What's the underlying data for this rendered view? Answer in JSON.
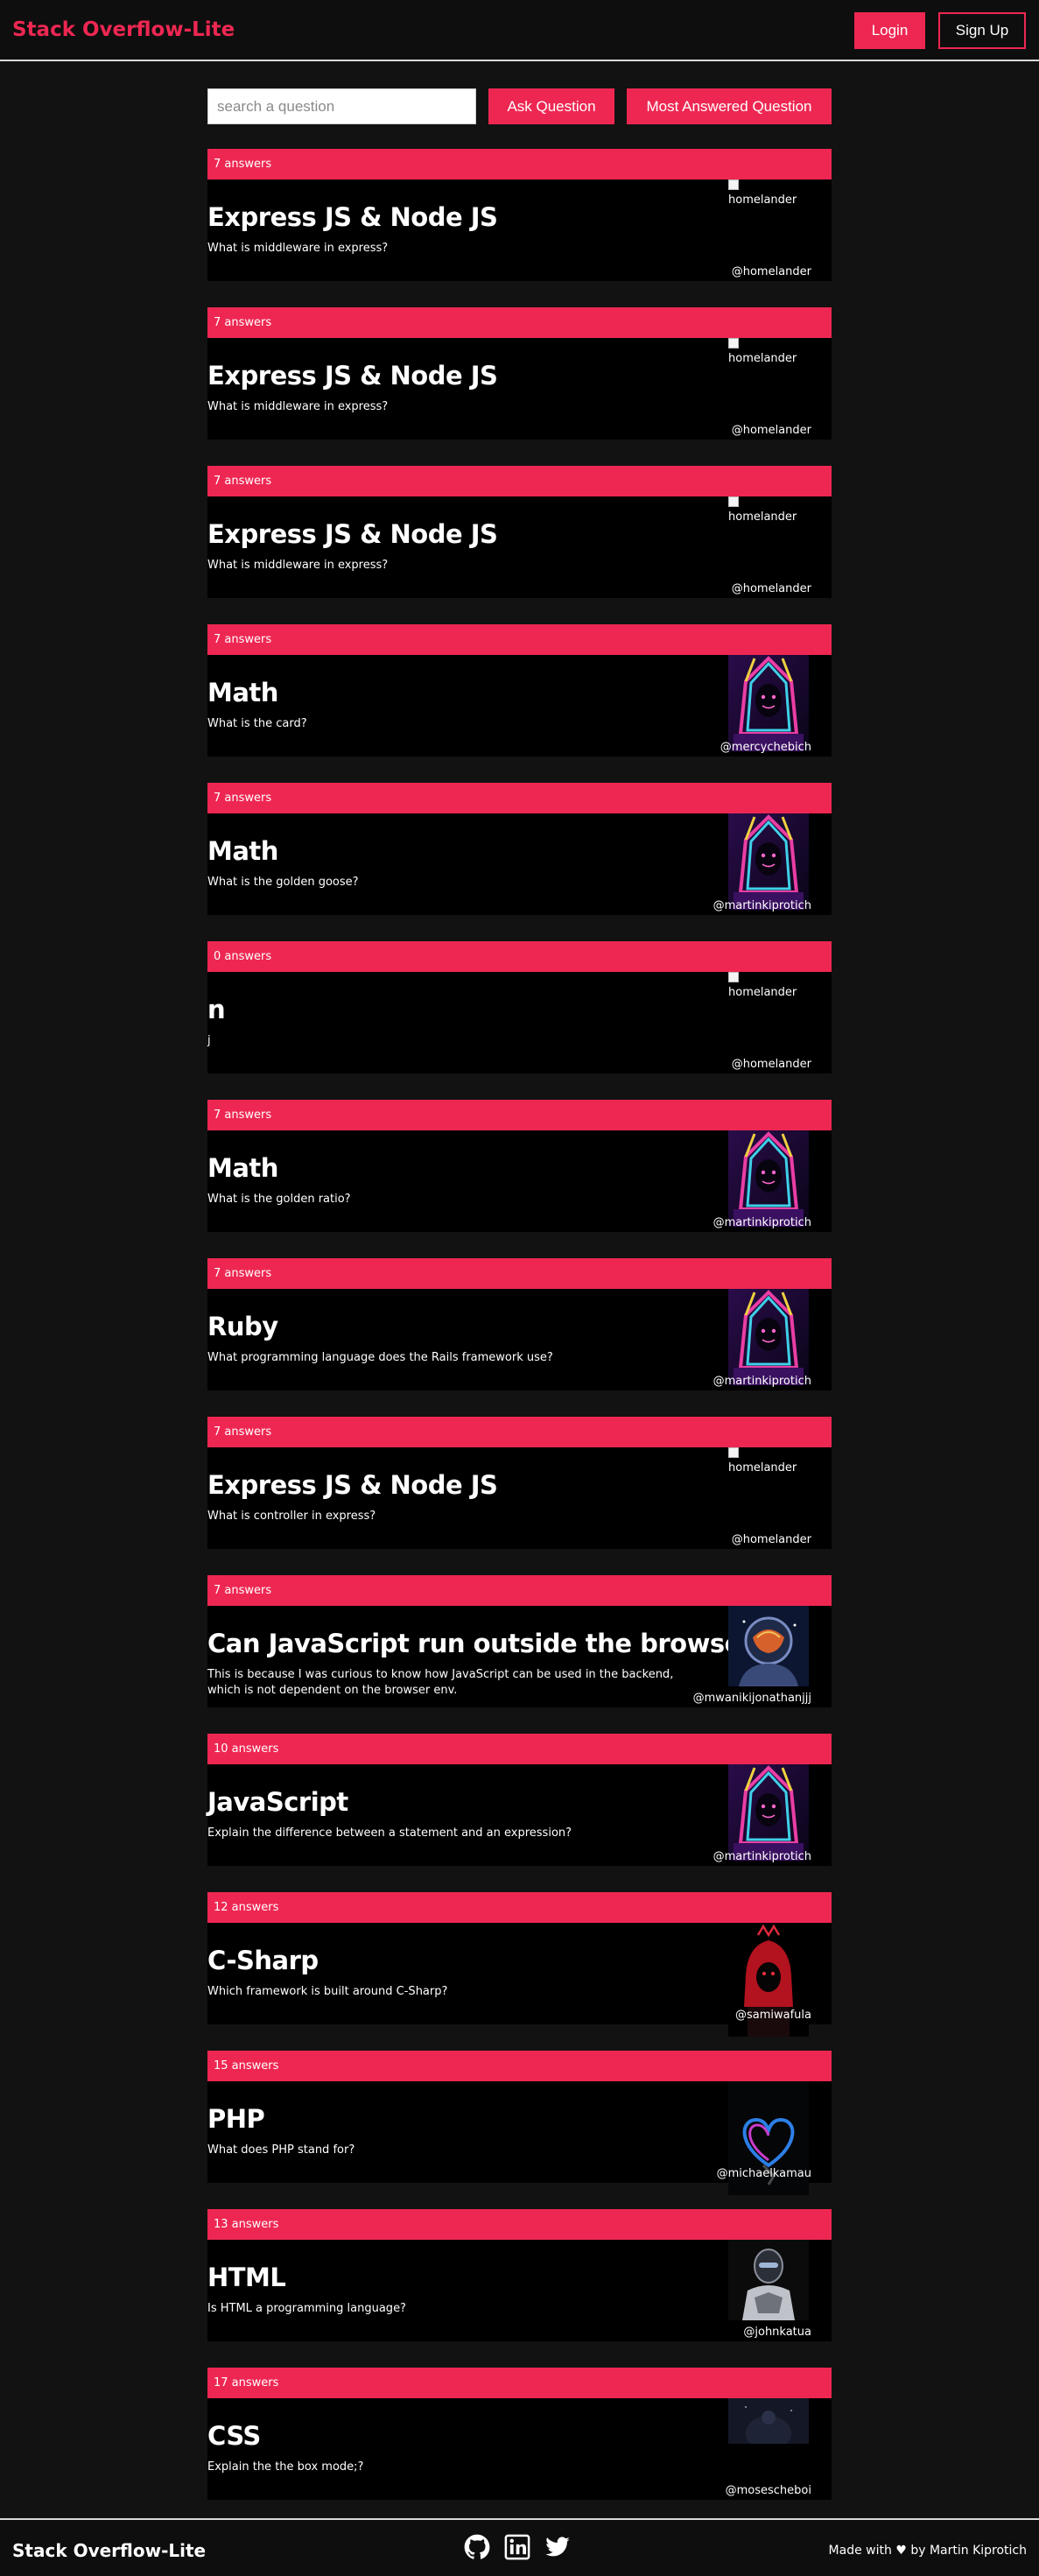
{
  "app": {
    "title": "Stack Overflow-Lite"
  },
  "nav": {
    "login_label": "Login",
    "signup_label": "Sign Up"
  },
  "toolbar": {
    "search_placeholder": "search a question",
    "ask_label": "Ask Question",
    "most_answered_label": "Most Answered Question"
  },
  "questions": [
    {
      "answers": "7 answers",
      "title": "Express JS & Node JS",
      "body": "What is middleware in express?",
      "user": "@homelander",
      "avatar": "broken",
      "alt": "homelander"
    },
    {
      "answers": "7 answers",
      "title": "Express JS & Node JS",
      "body": "What is middleware in express?",
      "user": "@homelander",
      "avatar": "broken",
      "alt": "homelander"
    },
    {
      "answers": "7 answers",
      "title": "Express JS & Node JS",
      "body": "What is middleware in express?",
      "user": "@homelander",
      "avatar": "broken",
      "alt": "homelander"
    },
    {
      "answers": "7 answers",
      "title": "Math",
      "body": "What is the card?",
      "user": "@mercychebich",
      "avatar": "neon-hood",
      "alt": ""
    },
    {
      "answers": "7 answers",
      "title": "Math",
      "body": "What is the golden goose?",
      "user": "@martinkiprotich",
      "avatar": "neon-hood",
      "alt": ""
    },
    {
      "answers": "0 answers",
      "title": "n",
      "body": "j",
      "user": "@homelander",
      "avatar": "broken",
      "alt": "homelander"
    },
    {
      "answers": "7 answers",
      "title": "Math",
      "body": "What is the golden ratio?",
      "user": "@martinkiprotich",
      "avatar": "neon-hood",
      "alt": ""
    },
    {
      "answers": "7 answers",
      "title": "Ruby",
      "body": "What programming language does the Rails framework use?",
      "user": "@martinkiprotich",
      "avatar": "neon-hood",
      "alt": ""
    },
    {
      "answers": "7 answers",
      "title": "Express JS & Node JS",
      "body": "What is controller in express?",
      "user": "@homelander",
      "avatar": "broken",
      "alt": "homelander"
    },
    {
      "answers": "7 answers",
      "title": "Can JavaScript run outside the browser?",
      "body": "This is because I was curious to know how JavaScript can be used in the backend, which is not dependent on the browser env.",
      "user": "@mwanikijonathanjjj",
      "avatar": "astronaut",
      "alt": ""
    },
    {
      "answers": "10 answers",
      "title": "JavaScript",
      "body": "Explain the difference between a statement and an expression?",
      "user": "@martinkiprotich",
      "avatar": "neon-hood",
      "alt": ""
    },
    {
      "answers": "12 answers",
      "title": "C-Sharp",
      "body": "Which framework is built around C-Sharp?",
      "user": "@samiwafula",
      "avatar": "red-hood",
      "alt": ""
    },
    {
      "answers": "15 answers",
      "title": "PHP",
      "body": "What does PHP stand for?",
      "user": "@michaelkamau",
      "avatar": "neon-heart",
      "alt": ""
    },
    {
      "answers": "13 answers",
      "title": "HTML",
      "body": "Is HTML a programming language?",
      "user": "@johnkatua",
      "avatar": "armored",
      "alt": ""
    },
    {
      "answers": "17 answers",
      "title": "CSS",
      "body": "Explain the the box mode;?",
      "user": "@mosescheboi",
      "avatar": "dark-figure",
      "alt": ""
    }
  ],
  "footer": {
    "brand": "Stack Overflow-Lite",
    "credit_prefix": "Made with",
    "credit_suffix": "by Martin Kiprotich",
    "icons": [
      "github-icon",
      "linkedin-icon",
      "twitter-icon"
    ]
  },
  "colors": {
    "accent": "#ee2752",
    "background": "#121212",
    "card": "#000000"
  }
}
